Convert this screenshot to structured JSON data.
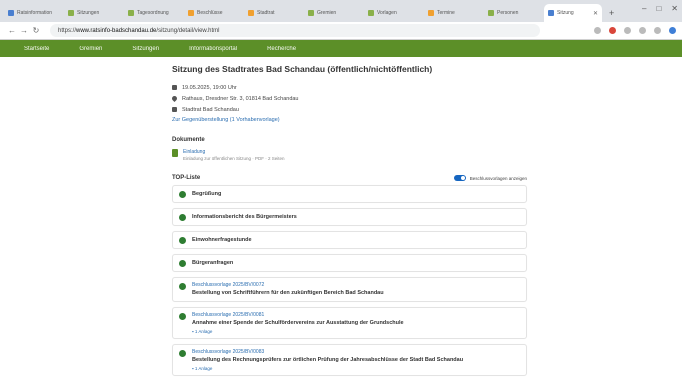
{
  "browser": {
    "tabs": [
      {
        "label": "Ratsinformation"
      },
      {
        "label": "Sitzungen"
      },
      {
        "label": "Tagesordnung"
      },
      {
        "label": "Beschlüsse"
      },
      {
        "label": "Stadtrat"
      },
      {
        "label": "Gremien"
      },
      {
        "label": "Vorlagen"
      },
      {
        "label": "Termine"
      },
      {
        "label": "Personen"
      },
      {
        "label": "Sitzung"
      }
    ],
    "url_prefix": "https://",
    "url_host": "www.ratsinfo-badschandau.de",
    "url_path": "/sitzung/detail/view.html"
  },
  "sitenav": {
    "items": [
      "Startseite",
      "Gremien",
      "Sitzungen",
      "Informationsportal",
      "Recherche"
    ]
  },
  "meeting": {
    "title": "Sitzung des Stadtrates Bad Schandau (öffentlich/nichtöffentlich)",
    "date": "19.05.2025, 19:00 Uhr",
    "address": "Rathaus, Dresdner Str. 3, 01814 Bad Schandau",
    "body": "Stadtrat Bad Schandau",
    "link": "Zur Gegenüberstellung (1 Vorhabenvorlage)"
  },
  "documents": {
    "label": "Dokumente",
    "items": [
      {
        "name": "Einladung",
        "sub": "Einladung zur öffentlichen Sitzung · PDF · 2 Seiten"
      }
    ]
  },
  "top_list": {
    "label": "TOP-Liste",
    "toggle_label": "Beschlussvorlagen anzeigen",
    "items": [
      {
        "ref": "",
        "title": "Begrüßung",
        "attachment": ""
      },
      {
        "ref": "",
        "title": "Informationsbericht des Bürgermeisters",
        "attachment": ""
      },
      {
        "ref": "",
        "title": "Einwohnerfragestunde",
        "attachment": ""
      },
      {
        "ref": "",
        "title": "Bürgeranfragen",
        "attachment": ""
      },
      {
        "ref": "Beschlussvorlage 2025/BV/0072",
        "title": "Bestellung von Schriftführern für den zukünftigen Bereich Bad Schandau",
        "attachment": ""
      },
      {
        "ref": "Beschlussvorlage 2025/BV/0081",
        "title": "Annahme einer Spende der Schulfördervereins zur Ausstattung der Grundschule",
        "attachment": "1 Anlage"
      },
      {
        "ref": "Beschlussvorlage 2025/BV/0083",
        "title": "Bestellung des Rechnungsprüfers zur örtlichen Prüfung der Jahresabschlüsse der Stadt Bad Schandau",
        "attachment": "1 Anlage"
      }
    ]
  }
}
